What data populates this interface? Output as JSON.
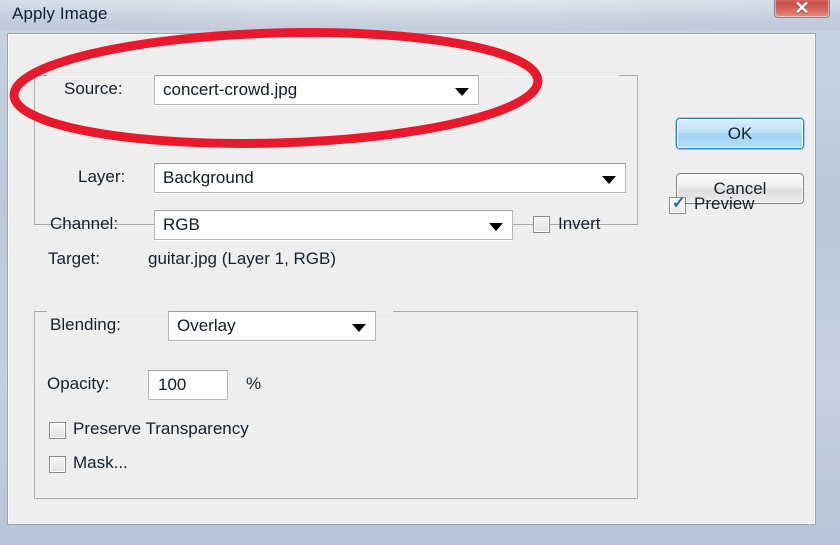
{
  "window": {
    "title": "Apply Image",
    "close_icon": "close-x-icon"
  },
  "source_group": {
    "source": {
      "label": "Source:",
      "value": "concert-crowd.jpg",
      "arrow_icon": "chevron-down-icon"
    },
    "layer": {
      "label": "Layer:",
      "value": "Background",
      "arrow_icon": "chevron-down-icon"
    },
    "channel": {
      "label": "Channel:",
      "value": "RGB",
      "arrow_icon": "chevron-down-icon"
    },
    "invert": {
      "label": "Invert",
      "checked": false
    }
  },
  "target": {
    "label": "Target:",
    "value": "guitar.jpg (Layer 1, RGB)"
  },
  "blending_group": {
    "blending": {
      "label": "Blending:",
      "value": "Overlay",
      "arrow_icon": "chevron-down-icon"
    },
    "opacity": {
      "label": "Opacity:",
      "value": "100",
      "unit": "%"
    },
    "preserve_transparency": {
      "label": "Preserve Transparency",
      "checked": false
    },
    "mask": {
      "label": "Mask...",
      "checked": false
    }
  },
  "actions": {
    "ok_label": "OK",
    "cancel_label": "Cancel",
    "preview": {
      "label": "Preview",
      "checked": true,
      "tick_glyph": "✓"
    }
  },
  "annotation": {
    "shape": "ellipse",
    "color": "#e8192c",
    "target": "Source:"
  },
  "colors": {
    "titlebar": "#c2cddd",
    "dialog_background": "#f1f1f1",
    "accent_ok": "#9ed4f3",
    "annotation_red": "#e8192c",
    "check_blue": "#1d5fbf"
  }
}
